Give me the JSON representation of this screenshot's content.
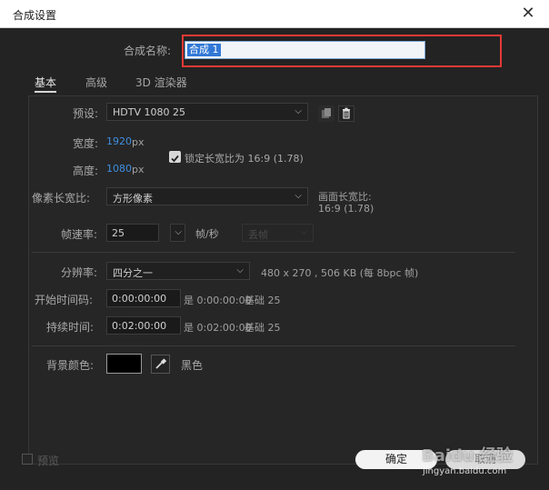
{
  "window": {
    "title": "合成设置",
    "close_glyph": "✕"
  },
  "name_row": {
    "label": "合成名称:",
    "value": "合成 1",
    "highlight_color": "#e53935"
  },
  "tabs": [
    "基本",
    "高级",
    "3D 渲染器"
  ],
  "preset": {
    "label": "预设:",
    "value": "HDTV 1080 25",
    "icons": [
      "copy-icon",
      "trash-icon"
    ]
  },
  "width": {
    "label": "宽度:",
    "value": "1920",
    "unit": "px"
  },
  "height": {
    "label": "高度:",
    "value": "1080",
    "unit": "px"
  },
  "lock_aspect": {
    "checked": true,
    "label": "锁定长宽比为 16:9 (1.78)"
  },
  "pixel_aspect": {
    "label": "像素长宽比:",
    "value": "方形像素",
    "frame_label": "画面长宽比:",
    "frame_value": "16:9 (1.78)"
  },
  "frame_rate": {
    "label": "帧速率:",
    "value": "25",
    "unit": "帧/秒",
    "drop_frame": "丢帧"
  },
  "resolution": {
    "label": "分辨率:",
    "value": "四分之一",
    "info": "480 x 270 , 506 KB (每 8bpc 帧)"
  },
  "start_timecode": {
    "label": "开始时间码:",
    "value": "0:00:00:00",
    "is_label": "是 0:00:00:00",
    "base": "基础 25"
  },
  "duration": {
    "label": "持续时间:",
    "value": "0:02:00:00",
    "is_label": "是 0:02:00:00",
    "base": "基础 25"
  },
  "background": {
    "label": "背景颜色:",
    "color": "#000000",
    "name": "黑色"
  },
  "footer": {
    "preview": "预览",
    "ok": "确定",
    "cancel": "取消"
  },
  "watermark": {
    "brand": "Baidu 经验",
    "url": "jingyan.baidu.com"
  }
}
